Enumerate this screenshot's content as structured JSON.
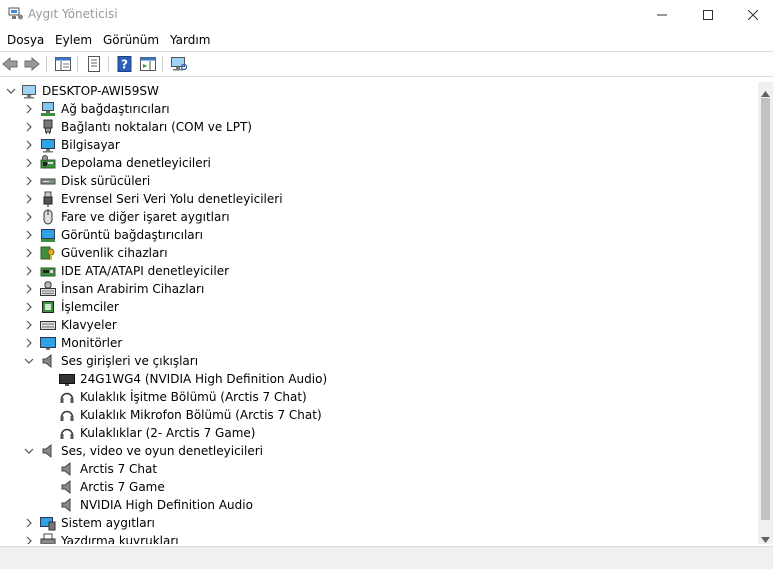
{
  "window": {
    "title": "Aygıt Yöneticisi"
  },
  "menu": [
    "Dosya",
    "Eylem",
    "Görünüm",
    "Yardım"
  ],
  "tree": {
    "root": "DESKTOP-AWI59SW",
    "categories": [
      {
        "label": "Ağ bağdaştırıcıları",
        "icon": "network-adapter-icon"
      },
      {
        "label": "Bağlantı noktaları (COM ve LPT)",
        "icon": "port-icon"
      },
      {
        "label": "Bilgisayar",
        "icon": "computer-icon"
      },
      {
        "label": "Depolama denetleyicileri",
        "icon": "storage-controller-icon"
      },
      {
        "label": "Disk sürücüleri",
        "icon": "disk-drive-icon"
      },
      {
        "label": "Evrensel Seri Veri Yolu denetleyicileri",
        "icon": "usb-icon"
      },
      {
        "label": "Fare ve diğer işaret aygıtları",
        "icon": "mouse-icon"
      },
      {
        "label": "Görüntü bağdaştırıcıları",
        "icon": "display-adapter-icon"
      },
      {
        "label": "Güvenlik cihazları",
        "icon": "security-device-icon"
      },
      {
        "label": "IDE ATA/ATAPI denetleyiciler",
        "icon": "ide-controller-icon"
      },
      {
        "label": "İnsan Arabirim Cihazları",
        "icon": "hid-icon"
      },
      {
        "label": "İşlemciler",
        "icon": "processor-icon"
      },
      {
        "label": "Klavyeler",
        "icon": "keyboard-icon"
      },
      {
        "label": "Monitörler",
        "icon": "monitor-icon"
      },
      {
        "label": "Ses girişleri ve çıkışları",
        "icon": "speaker-icon",
        "expanded": true,
        "children": [
          {
            "label": "24G1WG4 (NVIDIA High Definition Audio)",
            "icon": "monitor-audio-icon"
          },
          {
            "label": "Kulaklık İşitme Bölümü (Arctis 7 Chat)",
            "icon": "headphones-icon"
          },
          {
            "label": "Kulaklık Mikrofon Bölümü (Arctis 7 Chat)",
            "icon": "headphones-icon"
          },
          {
            "label": "Kulaklıklar (2- Arctis 7 Game)",
            "icon": "headphones-icon"
          }
        ]
      },
      {
        "label": "Ses, video ve oyun denetleyicileri",
        "icon": "speaker-icon",
        "expanded": true,
        "children": [
          {
            "label": "Arctis 7 Chat",
            "icon": "speaker-icon"
          },
          {
            "label": "Arctis 7 Game",
            "icon": "speaker-icon"
          },
          {
            "label": "NVIDIA High Definition Audio",
            "icon": "speaker-icon"
          }
        ]
      },
      {
        "label": "Sistem aygıtları",
        "icon": "system-device-icon"
      },
      {
        "label": "Yazdırma kuyrukları",
        "icon": "printer-icon"
      }
    ]
  }
}
